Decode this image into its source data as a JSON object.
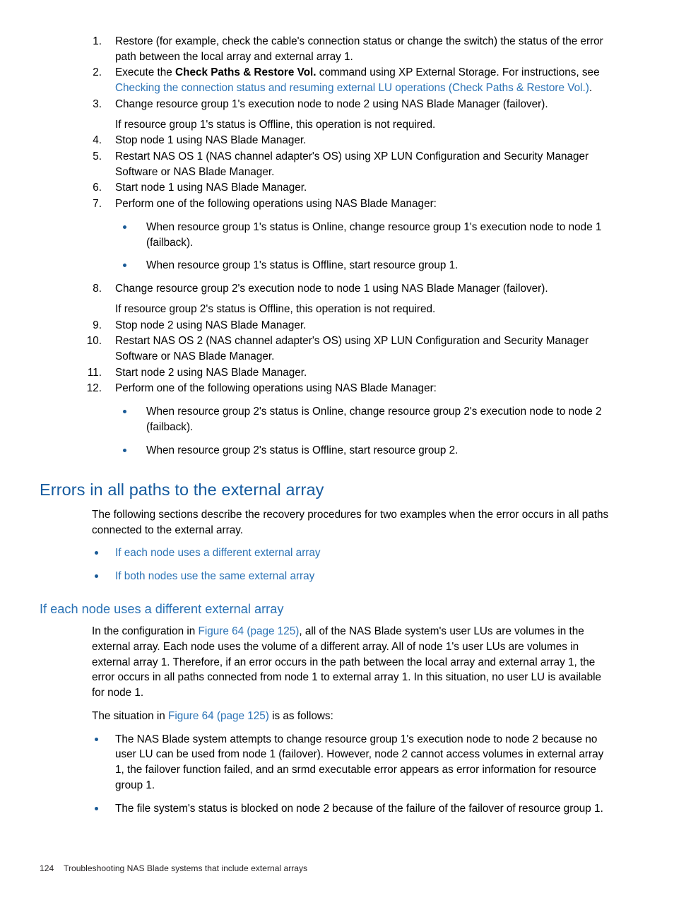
{
  "document": {
    "steps": [
      {
        "number": "1.",
        "parts": [
          {
            "type": "text",
            "value": "Restore (for example, check the cable's connection status or change the switch) the status of the error path between the local array and external array 1."
          }
        ]
      },
      {
        "number": "2.",
        "parts": [
          {
            "type": "text",
            "value": "Execute the "
          },
          {
            "type": "bold",
            "value": "Check Paths & Restore Vol."
          },
          {
            "type": "text",
            "value": " command using XP External Storage. For instructions, see "
          },
          {
            "type": "link",
            "value": "Checking the connection status and resuming external LU operations (Check Paths & Restore Vol.)"
          },
          {
            "type": "text",
            "value": "."
          }
        ]
      },
      {
        "number": "3.",
        "parts": [
          {
            "type": "text",
            "value": "Change resource group 1's execution node to node 2 using NAS Blade Manager (failover)."
          }
        ],
        "second_para": "If resource group 1's status is Offline, this operation is not required."
      },
      {
        "number": "4.",
        "parts": [
          {
            "type": "text",
            "value": "Stop node 1 using NAS Blade Manager."
          }
        ]
      },
      {
        "number": "5.",
        "parts": [
          {
            "type": "text",
            "value": "Restart NAS OS 1 (NAS channel adapter's OS) using XP LUN Configuration and Security Manager Software or NAS Blade Manager."
          }
        ]
      },
      {
        "number": "6.",
        "parts": [
          {
            "type": "text",
            "value": "Start node 1 using NAS Blade Manager."
          }
        ]
      },
      {
        "number": "7.",
        "parts": [
          {
            "type": "text",
            "value": "Perform one of the following operations using NAS Blade Manager:"
          }
        ],
        "bullets": [
          "When resource group 1's status is Online, change resource group 1's execution node to node 1 (failback).",
          "When resource group 1's status is Offline, start resource group 1."
        ]
      },
      {
        "number": "8.",
        "parts": [
          {
            "type": "text",
            "value": "Change resource group 2's execution node to node 1 using NAS Blade Manager (failover)."
          }
        ],
        "second_para": "If resource group 2's status is Offline, this operation is not required."
      },
      {
        "number": "9.",
        "parts": [
          {
            "type": "text",
            "value": "Stop node 2 using NAS Blade Manager."
          }
        ]
      },
      {
        "number": "10.",
        "parts": [
          {
            "type": "text",
            "value": "Restart NAS OS 2 (NAS channel adapter's OS) using XP LUN Configuration and Security Manager Software or NAS Blade Manager."
          }
        ]
      },
      {
        "number": "11.",
        "parts": [
          {
            "type": "text",
            "value": "Start node 2 using NAS Blade Manager."
          }
        ]
      },
      {
        "number": "12.",
        "parts": [
          {
            "type": "text",
            "value": "Perform one of the following operations using NAS Blade Manager:"
          }
        ],
        "bullets": [
          "When resource group 2's status is Online, change resource group 2's execution node to node 2 (failback).",
          "When resource group 2's status is Offline, start resource group 2."
        ]
      }
    ],
    "section": {
      "heading": "Errors in all paths to the external array",
      "intro": "The following sections describe the recovery procedures for two examples when the error occurs in all paths connected to the external array.",
      "links": [
        "If each node uses a different external array",
        "If both nodes use the same external array"
      ]
    },
    "subsection": {
      "heading": "If each node uses a different external array",
      "para1": {
        "parts": [
          {
            "type": "text",
            "value": "In the configuration in "
          },
          {
            "type": "link",
            "value": "Figure 64 (page 125)"
          },
          {
            "type": "text",
            "value": ", all of the NAS Blade system's user LUs are volumes in the external array. Each node uses the volume of a different array. All of node 1's user LUs are volumes in external array 1. Therefore, if an error occurs in the path between the local array and external array 1, the error occurs in all paths connected from node 1 to external array 1. In this situation, no user LU is available for node 1."
          }
        ]
      },
      "para2": {
        "parts": [
          {
            "type": "text",
            "value": "The situation in "
          },
          {
            "type": "link",
            "value": "Figure 64 (page 125)"
          },
          {
            "type": "text",
            "value": " is as follows:"
          }
        ]
      },
      "bullets": [
        "The NAS Blade system attempts to change resource group 1's execution node to node 2 because no user LU can be used from node 1 (failover). However, node 2 cannot access volumes in external array 1, the failover function failed, and an srmd executable error appears as error information for resource group 1.",
        "The file system's status is blocked on node 2 because of the failure of the failover of resource group 1."
      ]
    },
    "footer": {
      "page_number": "124",
      "chapter_title": "Troubleshooting NAS Blade systems that include external arrays"
    },
    "colors": {
      "link": "#2a72b5",
      "heading": "#145a9e",
      "subheading": "#2a72b5",
      "bullet": "#1a5a96",
      "body_text": "#000000",
      "footer_text": "#231f20"
    }
  }
}
